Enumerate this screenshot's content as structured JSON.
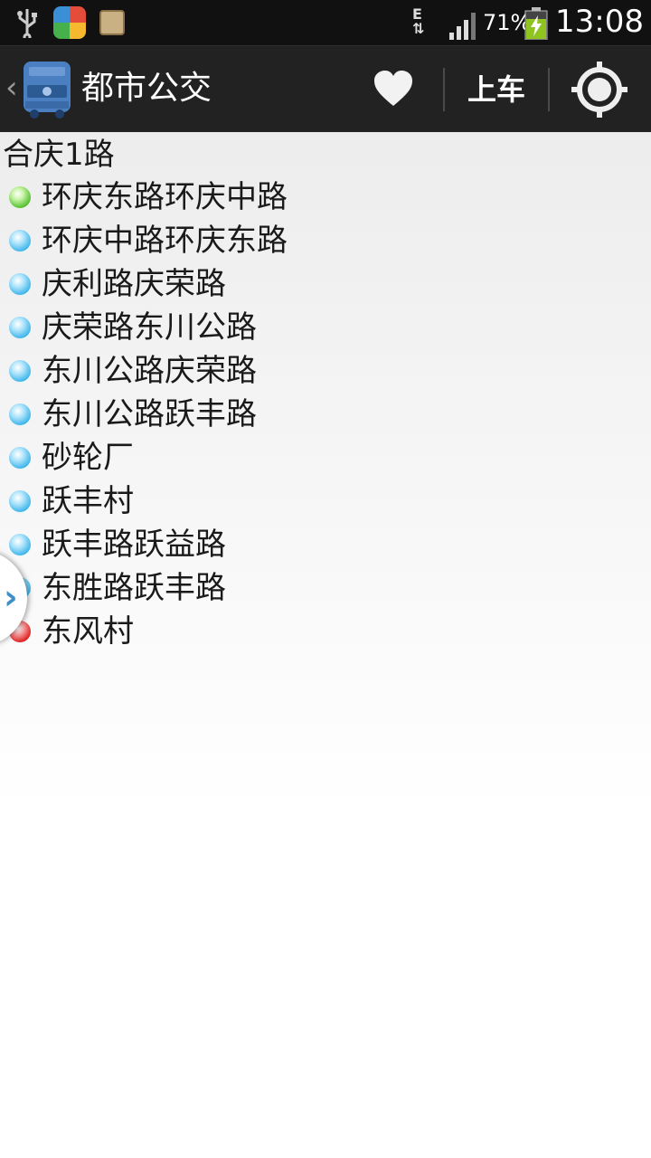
{
  "status_bar": {
    "network_type": "E",
    "battery_percent": "71%",
    "time": "13:08",
    "icons": [
      "usb-icon",
      "app-store-icon",
      "radio-icon",
      "data-transfer-icon",
      "signal-icon",
      "battery-charging-icon"
    ]
  },
  "action_bar": {
    "back_glyph": "‹",
    "title": "都市公交",
    "board_label": "上车",
    "icons": [
      "bus-logo-icon",
      "heart-icon",
      "locate-icon"
    ]
  },
  "route": {
    "title": "合庆1路",
    "stops": [
      {
        "name": "环庆东路环庆中路",
        "status": "green"
      },
      {
        "name": "环庆中路环庆东路",
        "status": "blue"
      },
      {
        "name": "庆利路庆荣路",
        "status": "blue"
      },
      {
        "name": "庆荣路东川公路",
        "status": "blue"
      },
      {
        "name": "东川公路庆荣路",
        "status": "blue"
      },
      {
        "name": "东川公路跃丰路",
        "status": "blue"
      },
      {
        "name": "砂轮厂",
        "status": "blue"
      },
      {
        "name": "跃丰村",
        "status": "blue"
      },
      {
        "name": "跃丰路跃益路",
        "status": "blue"
      },
      {
        "name": "东胜路跃丰路",
        "status": "blue"
      },
      {
        "name": "东风村",
        "status": "red"
      }
    ]
  },
  "drawer": {
    "chevron": "›"
  },
  "colors": {
    "actionbar": "#222222",
    "statusbar": "#111111",
    "accent": "#3f8ec7"
  }
}
